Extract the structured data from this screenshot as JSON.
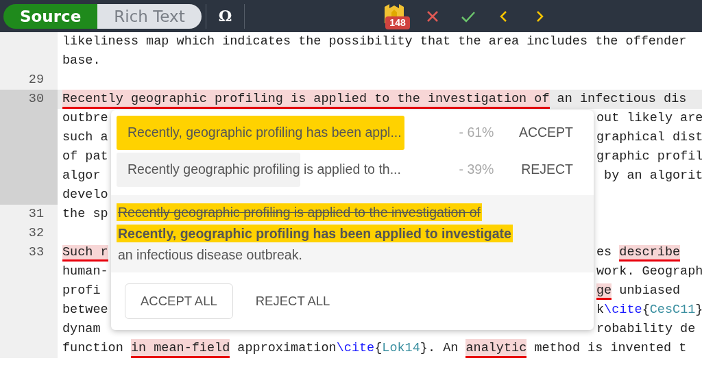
{
  "toolbar": {
    "modes": [
      {
        "label": "Source",
        "selected": true
      },
      {
        "label": "Rich Text",
        "selected": false
      }
    ],
    "symbol_button": "Ω",
    "issue_count": "148",
    "actions": [
      {
        "kind": "reject"
      },
      {
        "kind": "accept"
      },
      {
        "kind": "previous"
      },
      {
        "kind": "next"
      }
    ]
  },
  "editor": {
    "lines": [
      {
        "active": false,
        "full": [
          {
            "kind": "plain",
            "text": "likeliness map which indicates the possibility that the area includes the offender"
          }
        ]
      },
      {
        "active": false,
        "full": [
          {
            "kind": "plain",
            "text": "base."
          }
        ]
      },
      {
        "number": "29",
        "active": false
      },
      {
        "number": "30",
        "active": true,
        "full": [
          {
            "kind": "error",
            "text": "Recently geographic profiling is applied to the investigation of"
          },
          {
            "kind": "plain",
            "text": " an infectious dis"
          }
        ]
      },
      {
        "active": true,
        "left": [
          {
            "kind": "plain",
            "text": "outbre"
          }
        ],
        "right": [
          {
            "kind": "plain",
            "text": "out likely are"
          }
        ]
      },
      {
        "active": true,
        "left": [
          {
            "kind": "plain",
            "text": "such a"
          }
        ],
        "right": [
          {
            "kind": "plain",
            "text": "graphical dist"
          }
        ]
      },
      {
        "active": true,
        "left": [
          {
            "kind": "plain",
            "text": "of pat"
          }
        ],
        "right": [
          {
            "kind": "plain",
            "text": "graphic profil"
          }
        ]
      },
      {
        "active": true,
        "left": [
          {
            "kind": "plain",
            "text": "algor"
          }
        ],
        "right": [
          {
            "kind": "plain",
            "text": " by an algorit"
          }
        ]
      },
      {
        "active": true,
        "left": [
          {
            "kind": "plain",
            "text": "develo"
          }
        ]
      },
      {
        "number": "31",
        "active": false,
        "left": [
          {
            "kind": "plain",
            "text": "the sp"
          }
        ]
      },
      {
        "number": "32",
        "active": false
      },
      {
        "number": "33",
        "active": false,
        "left": [
          {
            "kind": "error",
            "text": "Such r"
          }
        ],
        "right": [
          {
            "kind": "plain",
            "text": "es "
          },
          {
            "kind": "error",
            "text": "describe"
          }
        ]
      },
      {
        "active": false,
        "left": [
          {
            "kind": "plain",
            "text": "human-"
          }
        ],
        "right": [
          {
            "kind": "plain",
            "text": "work. Geograph"
          }
        ]
      },
      {
        "active": false,
        "left": [
          {
            "kind": "plain",
            "text": "profi"
          }
        ],
        "right": [
          {
            "kind": "error",
            "text": "ge"
          },
          {
            "kind": "plain",
            "text": " unbiased"
          }
        ]
      },
      {
        "active": false,
        "left": [
          {
            "kind": "plain",
            "text": "betwee"
          }
        ],
        "right": [
          {
            "kind": "plain",
            "text": "k"
          },
          {
            "kind": "command",
            "text": "\\cite"
          },
          {
            "kind": "plain",
            "text": "{"
          },
          {
            "kind": "arg",
            "text": "CesC11"
          },
          {
            "kind": "plain",
            "text": "}"
          }
        ]
      },
      {
        "active": false,
        "left": [
          {
            "kind": "plain",
            "text": "dynam"
          }
        ],
        "right": [
          {
            "kind": "plain",
            "text": "robability de"
          }
        ]
      },
      {
        "active": false,
        "full": [
          {
            "kind": "plain",
            "text": "function "
          },
          {
            "kind": "error",
            "text": "in mean-field"
          },
          {
            "kind": "plain",
            "text": " approximation"
          },
          {
            "kind": "command",
            "text": "\\cite"
          },
          {
            "kind": "plain",
            "text": "{"
          },
          {
            "kind": "arg",
            "text": "Lok14"
          },
          {
            "kind": "plain",
            "text": "}. An "
          },
          {
            "kind": "error",
            "text": "analytic"
          },
          {
            "kind": "plain",
            "text": " method is invented t"
          }
        ]
      }
    ]
  },
  "suggestion_popup": {
    "suggestions": [
      {
        "text": "Recently, geographic profiling has been appl...",
        "score": "- 61%",
        "action": "ACCEPT",
        "level": 0.61,
        "selected": true
      },
      {
        "text": "Recently geographic profiling is applied to th...",
        "score": "- 39%",
        "action": "REJECT",
        "level": 0.39,
        "selected": false
      }
    ],
    "diff": [
      {
        "kind": "deleted",
        "text": "Recently geographic profiling is applied to the investigation of"
      },
      {
        "kind": "inserted",
        "text": "Recently, geographic profiling has been applied to investigate"
      },
      {
        "kind": "unchanged",
        "text": "an infectious disease outbreak."
      }
    ],
    "buttons": [
      {
        "label": "ACCEPT ALL",
        "kind": "outlined"
      },
      {
        "label": "REJECT ALL",
        "kind": "plain"
      }
    ]
  }
}
